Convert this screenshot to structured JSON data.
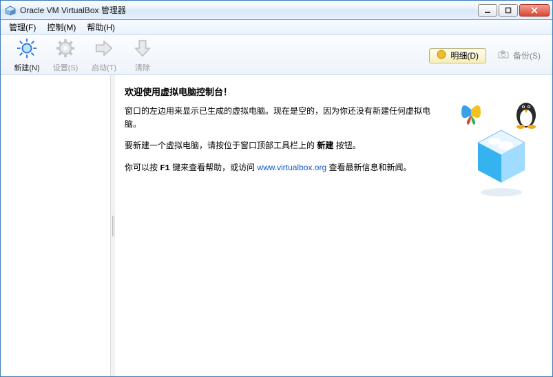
{
  "window": {
    "title": "Oracle VM VirtualBox 管理器"
  },
  "menu": {
    "file": "管理(F)",
    "control": "控制(M)",
    "help": "帮助(H)"
  },
  "toolbar": {
    "new": "新建(N)",
    "settings": "设置(S)",
    "start": "启动(T)",
    "discard": "清除",
    "details": "明细(D)",
    "snapshots": "备份(S)"
  },
  "colors": {
    "accent_yellow": "#f0be2d",
    "link": "#1359c4"
  },
  "welcome": {
    "heading": "欢迎使用虚拟电脑控制台！",
    "p1": "窗口的左边用来显示已生成的虚拟电脑。现在是空的，因为你还没有新建任何虚拟电脑。",
    "p2a": "要新建一个虚拟电脑，请按位于窗口顶部工具栏上的 ",
    "p2_bold": "新建",
    "p2b": " 按钮。",
    "p3a": "你可以按 ",
    "p3_key": "F1",
    "p3b": " 键来查看帮助，或访问 ",
    "p3_link_text": "www.virtualbox.org",
    "p3_link_href": "http://www.virtualbox.org",
    "p3c": " 查看最新信息和新闻。"
  }
}
